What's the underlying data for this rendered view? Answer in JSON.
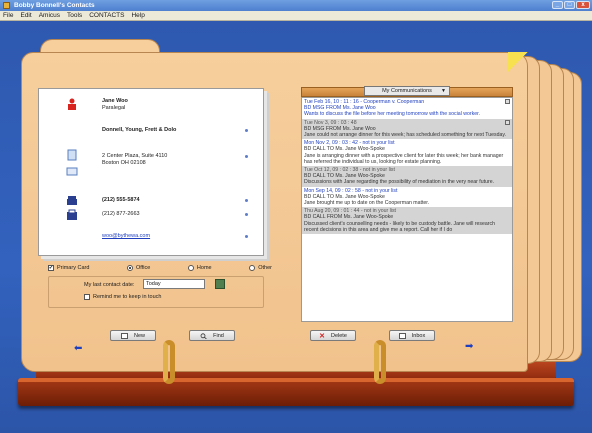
{
  "window": {
    "title": "Bobby Bonnell's Contacts",
    "buttons": [
      "_",
      "□",
      "x"
    ]
  },
  "menu": [
    "File",
    "Edit",
    "Amicus",
    "Tools",
    "CONTACTS",
    "Help"
  ],
  "card": {
    "name": "Jane Woo",
    "title": "Paralegal",
    "company": "Donnell, Young, Frett & Dolo",
    "address1": "2 Center Plaza, Suite 4110",
    "address2": "Boston OH 02108",
    "phone1": "(212) 555-5874",
    "phone2": "(212) 877-2663",
    "email": "woo@bythewa.com"
  },
  "options": {
    "primary_card": "Primary Card",
    "office": "Office",
    "home": "Home",
    "other": "Other",
    "last_contact_label": "My last contact date:",
    "last_contact_value": "Today",
    "remind_label": "Remind me to keep in touch"
  },
  "communications": {
    "selector": "My Communications",
    "entries": [
      {
        "head": "Tue Feb 16, 10 : 11 : 16 - Cooperman v. Cooperman",
        "body": "BD MSG FROM Ms. Jane Woo\nWants to discuss the file before her meeting tomorrow with the social worker.",
        "alt": false,
        "first": true
      },
      {
        "head": "Tue Nov 3, 09 : 03 : 48",
        "body": "BD MSG FROM Ms. Jane Woo\nJane could not arrange dinner for this week; has scheduled something for next Tuesday.",
        "alt": true,
        "first": false
      },
      {
        "head": "Mon Nov 2, 09 : 03 : 42 - not in your list",
        "body": "BD CALL TO Ms. Jane Woo-Spoke\nJane is arranging dinner with a prospective client for later this week; her bank manager has referred the individual to us, looking for estate planning.",
        "alt": false,
        "first": false
      },
      {
        "head": "Tue Oct 12, 09 : 02 : 38 - not in your list",
        "body": "BD CALL TO Ms. Jane Woo-Spoke\nDiscussions with Jane regarding the possibility of mediation in the very near future.",
        "alt": true,
        "first": false
      },
      {
        "head": "Mon Sep 14, 09 : 02 : 58 - not in your list",
        "body": "BD CALL TO Ms. Jane Woo-Spoke\nJane brought me up to date on the Cooperman matter.",
        "alt": false,
        "first": false
      },
      {
        "head": "Thu Aug 20, 09 : 01 : 44 - not in your list",
        "body": "BD CALL FROM Ms. Jane Woo-Spoke\nDiscussed client's counselling needs - likely to be custody battle. Jane will research recent decisions in this area and give me a report. Call her if I do",
        "alt": true,
        "first": false
      }
    ]
  },
  "buttons": {
    "new": "New",
    "find": "Find",
    "delete": "Delete",
    "inbox": "Inbox"
  },
  "colors": {
    "desktop": "#2f59b0",
    "card": "#f6cf9d",
    "base": "#a83a16",
    "link": "#1f3fbf"
  }
}
